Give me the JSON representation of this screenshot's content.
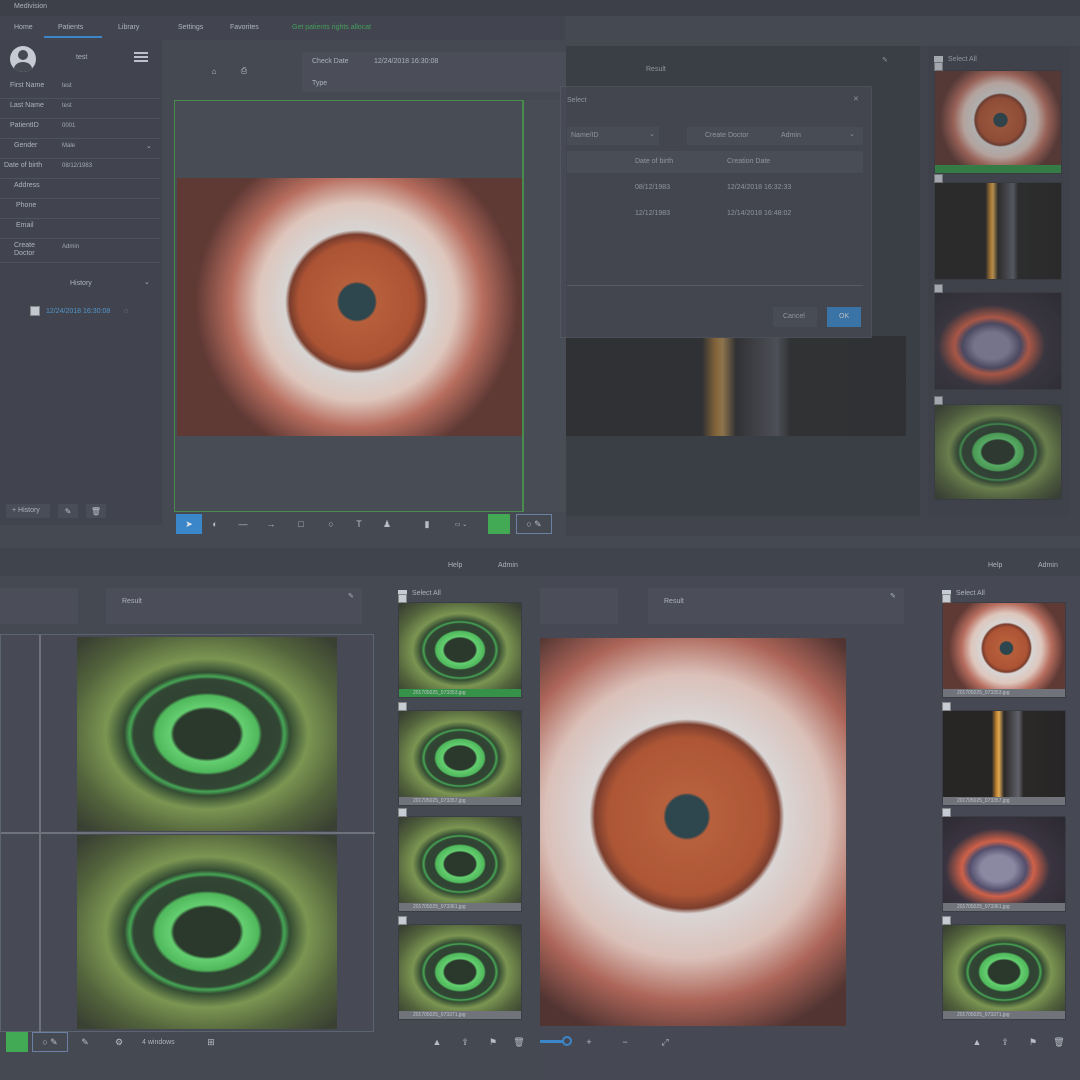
{
  "app": {
    "title": "Medivision"
  },
  "nav": {
    "home": "Home",
    "patients": "Patients",
    "library": "Library",
    "settings": "Settings",
    "favorites": "Favorites",
    "status": "Get patients rights allocat"
  },
  "patient": {
    "name_header": "test",
    "first_name_label": "First Name",
    "first_name": "test",
    "last_name_label": "Last Name",
    "last_name": "test",
    "patient_id_label": "PatientID",
    "patient_id": "0001",
    "gender_label": "Gender",
    "gender": "Male",
    "dob_label": "Date of birth",
    "dob": "08/12/1983",
    "address_label": "Address",
    "phone_label": "Phone",
    "email_label": "Email",
    "doctor_label": "Create Doctor",
    "doctor": "Admin",
    "history_label": "History",
    "history_item": "12/24/2018 16:30:08",
    "add_history": "+ History"
  },
  "check": {
    "date_label": "Check Date",
    "date": "12/24/2018 16:30:08",
    "type_label": "Type",
    "result": "Result"
  },
  "dialog": {
    "title": "Select",
    "filter_left": "Name/ID",
    "filter_right_label": "Create Doctor",
    "filter_right": "Admin",
    "col_dob": "Date of birth",
    "col_created": "Creation Date",
    "rows": [
      {
        "dob": "08/12/1983",
        "created": "12/24/2018 16:32:33"
      },
      {
        "dob": "12/12/1983",
        "created": "12/14/2018 16:48:02"
      }
    ],
    "cancel": "Cancel",
    "ok": "OK"
  },
  "right": {
    "select_all": "Select All",
    "help": "Help",
    "admin": "Admin"
  },
  "thumbs_bottom_left": [
    "201705025_073353.jpg",
    "201705025_073357.jpg",
    "201705025_073361.jpg",
    "201705025_073371.jpg"
  ],
  "thumbs_bottom_right": [
    "201705025_073353.jpg",
    "201705025_073357.jpg",
    "201705025_073361.jpg",
    "201705025_073371.jpg"
  ],
  "toolbar": {
    "windows_label": "4 windows",
    "zoom_plus": "+",
    "zoom_minus": "−",
    "fit": "⤢"
  },
  "colors": {
    "accent": "#2e88d6",
    "green": "#36b24a",
    "bg": "#3b3e47"
  }
}
